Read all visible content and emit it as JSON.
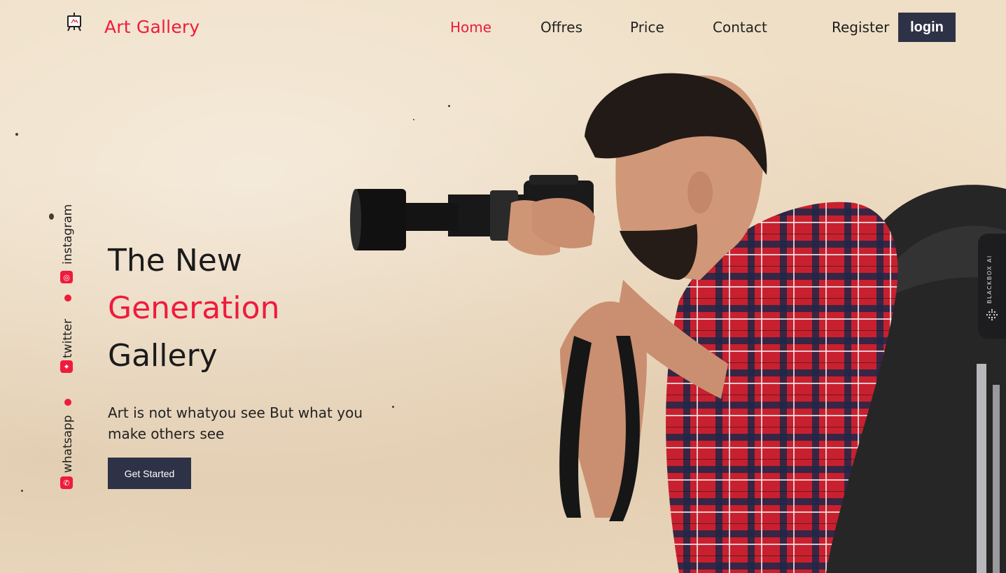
{
  "brand": {
    "name": "Art Gallery",
    "icon": "easel-icon"
  },
  "nav": {
    "links": [
      {
        "label": "Home",
        "active": true
      },
      {
        "label": "Offres",
        "active": false
      },
      {
        "label": "Price",
        "active": false
      },
      {
        "label": "Contact",
        "active": false
      }
    ],
    "register_label": "Register",
    "login_label": "login"
  },
  "social": [
    {
      "label": "instagram",
      "icon": "instagram-icon"
    },
    {
      "label": "twitter",
      "icon": "twitter-icon"
    },
    {
      "label": "whatsapp",
      "icon": "whatsapp-icon"
    }
  ],
  "hero": {
    "line1": "The New",
    "line2": "Generation",
    "line3": "Gallery",
    "tagline": "Art is not whatyou see But what you make others see",
    "cta_label": "Get Started"
  },
  "side_tab": {
    "label": "BLACKBOX AI"
  },
  "colors": {
    "accent": "#ef1b3c",
    "dark": "#2e3246",
    "background": "#efdfc6"
  }
}
